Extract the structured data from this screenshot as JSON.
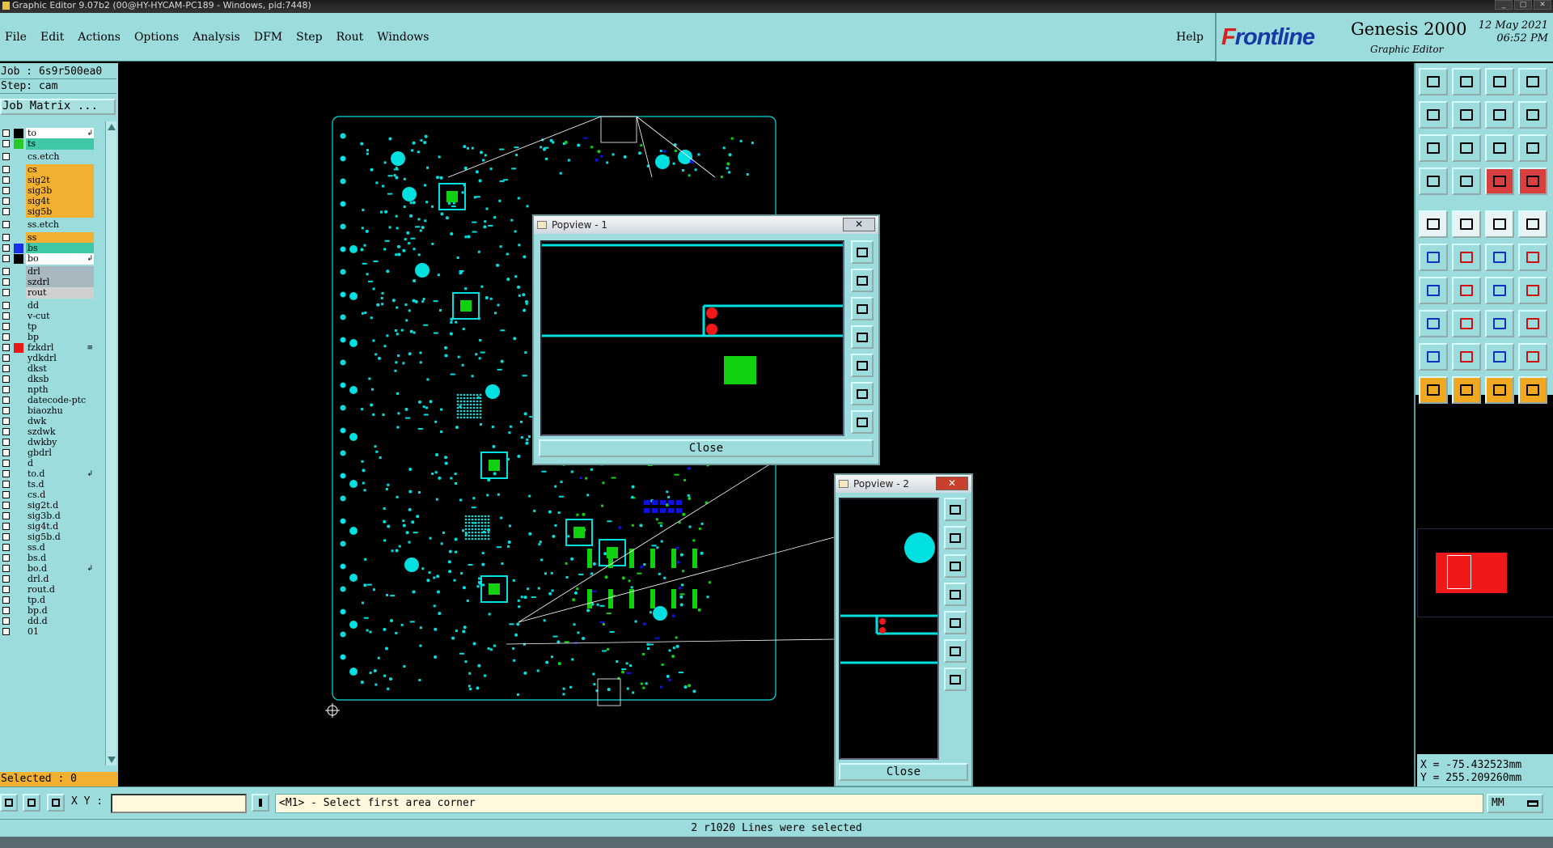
{
  "window": {
    "title": "Graphic Editor 9.07b2 (00@HY-HYCAM-PC189 - Windows, pid:7448)"
  },
  "menu": {
    "items": [
      "File",
      "Edit",
      "Actions",
      "Options",
      "Analysis",
      "DFM",
      "Step",
      "Rout",
      "Windows"
    ],
    "help": "Help"
  },
  "brand": {
    "logo_prefix": "F",
    "logo_rest": "rontline",
    "product": "Genesis 2000",
    "subtitle": "Graphic Editor",
    "date": "12 May 2021",
    "time": "06:52 PM"
  },
  "job": {
    "job_line": "Job : 6s9r500ea0",
    "step_line": "Step: cam",
    "matrix_button": "Job Matrix ..."
  },
  "layers": [
    {
      "name": "to",
      "color": "#000000",
      "bg": "#ffffff",
      "mark": "arrow"
    },
    {
      "name": "ts",
      "color": "#28c828",
      "bg": "#40c8a8",
      "mark": ""
    },
    {
      "name": "cs.etch",
      "color": "",
      "bg": "#9cdcdc",
      "mark": "",
      "gap": true
    },
    {
      "name": "cs",
      "color": "",
      "bg": "#f2b030",
      "mark": "",
      "gap": true
    },
    {
      "name": "sig2t",
      "color": "",
      "bg": "#f2b030",
      "mark": ""
    },
    {
      "name": "sig3b",
      "color": "",
      "bg": "#f2b030",
      "mark": ""
    },
    {
      "name": "sig4t",
      "color": "",
      "bg": "#f2b030",
      "mark": ""
    },
    {
      "name": "sig5b",
      "color": "",
      "bg": "#f2b030",
      "mark": ""
    },
    {
      "name": "ss.etch",
      "color": "",
      "bg": "#9cdcdc",
      "mark": "",
      "gap": true
    },
    {
      "name": "ss",
      "color": "",
      "bg": "#f2b030",
      "mark": "",
      "gap": true
    },
    {
      "name": "bs",
      "color": "#1830e8",
      "bg": "#40c8a8",
      "mark": ""
    },
    {
      "name": "bo",
      "color": "#000000",
      "bg": "#ffffff",
      "mark": "arrow"
    },
    {
      "name": "drl",
      "color": "",
      "bg": "#a8b8c0",
      "mark": "",
      "gap": true
    },
    {
      "name": "szdrl",
      "color": "",
      "bg": "#a8b8c0",
      "mark": ""
    },
    {
      "name": "rout",
      "color": "",
      "bg": "#d0d0d0",
      "mark": ""
    },
    {
      "name": "dd",
      "color": "",
      "bg": "#9cdcdc",
      "mark": "",
      "gap": true
    },
    {
      "name": "v-cut",
      "color": "",
      "bg": "#9cdcdc",
      "mark": ""
    },
    {
      "name": "tp",
      "color": "",
      "bg": "#9cdcdc",
      "mark": ""
    },
    {
      "name": "bp",
      "color": "",
      "bg": "#9cdcdc",
      "mark": ""
    },
    {
      "name": "fzkdrl",
      "color": "#e81818",
      "bg": "#9cdcdc",
      "mark": "lines"
    },
    {
      "name": "ydkdrl",
      "color": "",
      "bg": "#9cdcdc",
      "mark": ""
    },
    {
      "name": "dkst",
      "color": "",
      "bg": "#9cdcdc",
      "mark": ""
    },
    {
      "name": "dksb",
      "color": "",
      "bg": "#9cdcdc",
      "mark": ""
    },
    {
      "name": "npth",
      "color": "",
      "bg": "#9cdcdc",
      "mark": ""
    },
    {
      "name": "datecode-ptc",
      "color": "",
      "bg": "#9cdcdc",
      "mark": ""
    },
    {
      "name": "biaozhu",
      "color": "",
      "bg": "#9cdcdc",
      "mark": ""
    },
    {
      "name": "dwk",
      "color": "",
      "bg": "#9cdcdc",
      "mark": ""
    },
    {
      "name": "szdwk",
      "color": "",
      "bg": "#9cdcdc",
      "mark": ""
    },
    {
      "name": "dwkby",
      "color": "",
      "bg": "#9cdcdc",
      "mark": ""
    },
    {
      "name": "gbdrl",
      "color": "",
      "bg": "#9cdcdc",
      "mark": ""
    },
    {
      "name": "d",
      "color": "",
      "bg": "#9cdcdc",
      "mark": ""
    },
    {
      "name": "to.d",
      "color": "",
      "bg": "#9cdcdc",
      "mark": "arrow"
    },
    {
      "name": "ts.d",
      "color": "",
      "bg": "#9cdcdc",
      "mark": ""
    },
    {
      "name": "cs.d",
      "color": "",
      "bg": "#9cdcdc",
      "mark": ""
    },
    {
      "name": "sig2t.d",
      "color": "",
      "bg": "#9cdcdc",
      "mark": ""
    },
    {
      "name": "sig3b.d",
      "color": "",
      "bg": "#9cdcdc",
      "mark": ""
    },
    {
      "name": "sig4t.d",
      "color": "",
      "bg": "#9cdcdc",
      "mark": ""
    },
    {
      "name": "sig5b.d",
      "color": "",
      "bg": "#9cdcdc",
      "mark": ""
    },
    {
      "name": "ss.d",
      "color": "",
      "bg": "#9cdcdc",
      "mark": ""
    },
    {
      "name": "bs.d",
      "color": "",
      "bg": "#9cdcdc",
      "mark": ""
    },
    {
      "name": "bo.d",
      "color": "",
      "bg": "#9cdcdc",
      "mark": "arrow"
    },
    {
      "name": "drl.d",
      "color": "",
      "bg": "#9cdcdc",
      "mark": ""
    },
    {
      "name": "rout.d",
      "color": "",
      "bg": "#9cdcdc",
      "mark": ""
    },
    {
      "name": "tp.d",
      "color": "",
      "bg": "#9cdcdc",
      "mark": ""
    },
    {
      "name": "bp.d",
      "color": "",
      "bg": "#9cdcdc",
      "mark": ""
    },
    {
      "name": "dd.d",
      "color": "",
      "bg": "#9cdcdc",
      "mark": ""
    },
    {
      "name": "01",
      "color": "",
      "bg": "#9cdcdc",
      "mark": ""
    }
  ],
  "selected": "Selected : 0",
  "popview1": {
    "title": "Popview - 1",
    "close_label": "Close"
  },
  "popview2": {
    "title": "Popview - 2",
    "close_label": "Close"
  },
  "coords": {
    "x_line": "X = -75.432523mm",
    "y_line": "Y = 255.209260mm"
  },
  "bottom": {
    "xy_label": "X Y :",
    "xy_value": "",
    "prompt": "<M1> - Select first area corner",
    "units": "MM"
  },
  "status": "2 r1020 Lines were selected",
  "colors": {
    "panel": "#9cdcdc",
    "selected_bg": "#f2b030",
    "pad_cyan": "#00e0e0",
    "pad_green": "#10d010",
    "pad_blue": "#1010e0",
    "highlight_red": "#f01818"
  }
}
